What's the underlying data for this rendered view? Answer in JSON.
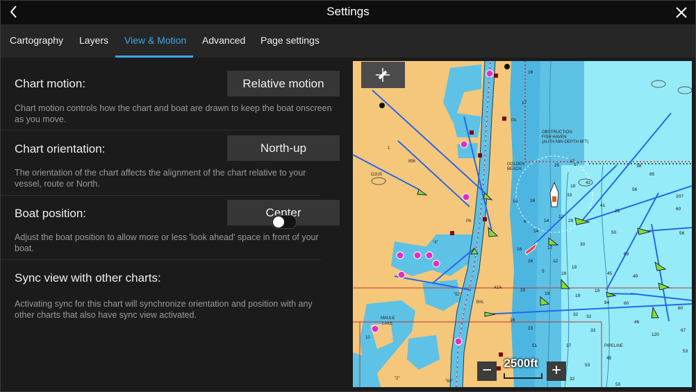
{
  "header": {
    "title": "Settings"
  },
  "tabs": [
    {
      "label": "Cartography"
    },
    {
      "label": "Layers"
    },
    {
      "label": "View & Motion",
      "active": true
    },
    {
      "label": "Advanced"
    },
    {
      "label": "Page settings"
    }
  ],
  "settings": {
    "chart_motion": {
      "label": "Chart motion:",
      "value": "Relative motion",
      "description": "Chart motion controls how the chart and boat are drawn to keep the boat onscreen as you move."
    },
    "chart_orientation": {
      "label": "Chart orientation:",
      "value": "North-up",
      "description": "The orientation of the chart affects the alignment of the chart relative to your vessel, route or North."
    },
    "boat_position": {
      "label": "Boat position:",
      "value": "Center",
      "description": "Adjust the boat position to allow more or less 'look ahead' space in front of your boat."
    },
    "sync_view": {
      "label": "Sync view with other charts:",
      "enabled": false,
      "description": "Activating sync for this chart will synchronize orientation and position with any other charts that also have sync view activated."
    }
  },
  "map": {
    "scale_label": "2500ft",
    "zoom_out": "−",
    "zoom_in": "+",
    "labels": {
      "obstruction": "OBSTRUCTION",
      "fish_haven": "FISH HAVEN",
      "auth_min_depth": "(AUTH MIN DEPTH 6FT)",
      "golden": "GOLDEN",
      "beach": "BEACH",
      "maule": "MAULE",
      "lake": "LAKE",
      "pa_1": "PA",
      "pa_2": "PA",
      "shl": "SHL",
      "a1a": "A1A",
      "pipeline": "PIPELINE",
      "ojus": "OJUS",
      "land_856": "856",
      "land_1": "1",
      "land_10": "10",
      "land_2": "\"2\"",
      "land_60": "\"60\"",
      "land_52": "\"52\"",
      "land_4": "\"4\""
    },
    "soundings": [
      "17",
      "16",
      "25",
      "32",
      "33",
      "38",
      "85",
      "56",
      "207",
      "14",
      "16",
      "16",
      "29",
      "30",
      "41",
      "63",
      "50",
      "19",
      "17",
      "45",
      "49",
      "60",
      "19",
      "84",
      "16",
      "20",
      "32",
      "32",
      "46",
      "120",
      "67",
      "33",
      "23",
      "37",
      "45",
      "50",
      "53",
      "51",
      "32",
      "12",
      "14",
      "18",
      "6",
      "14",
      "16",
      "5",
      "18",
      "19",
      "12",
      "17",
      "42",
      "53",
      "60",
      "56",
      "25",
      "60",
      "19"
    ]
  },
  "colors": {
    "accent": "#3ea6e6",
    "land": "#f5c77a",
    "shallow_water": "#5dc2e6",
    "deep_water": "#95ecf8",
    "route": "#2767e8",
    "target_green": "#7fe02f"
  }
}
